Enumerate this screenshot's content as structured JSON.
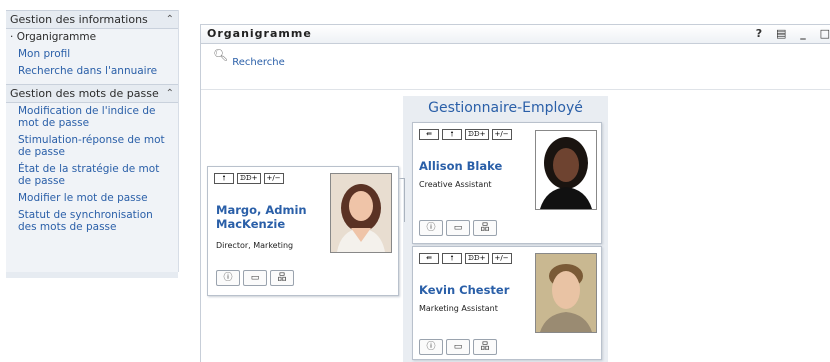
{
  "sidebar": {
    "section1": {
      "label": "Gestion des informations",
      "collapse": "⌃"
    },
    "items1": [
      {
        "label": "Organigramme",
        "bullet": "·"
      },
      {
        "label": "Mon profil"
      },
      {
        "label": "Recherche dans l'annuaire"
      }
    ],
    "section2": {
      "label": "Gestion des mots de passe",
      "collapse": "⌃"
    },
    "items2": [
      {
        "label": "Modification de l'indice de mot de passe"
      },
      {
        "label": "Stimulation-réponse de mot de passe"
      },
      {
        "label": "État de la stratégie de mot de passe"
      },
      {
        "label": "Modifier le mot de passe"
      },
      {
        "label": "Statut de synchronisation des mots de passe"
      }
    ]
  },
  "portlet": {
    "title": "Organigramme",
    "tools": {
      "help": "?",
      "print": "▤",
      "minimize": "_",
      "maximize": "□"
    },
    "search_label": "Recherche"
  },
  "group": {
    "title": "Gestionnaire-Employé"
  },
  "manager": {
    "name_line1": "Margo, Admin",
    "name_line2": "MacKenzie",
    "title": "Director, Marketing",
    "toolbar": [
      "🠕",
      "ᗬᗬ+",
      "+/−"
    ]
  },
  "employees": [
    {
      "name": "Allison Blake",
      "title": "Creative Assistant",
      "toolbar": [
        "⇚",
        "🠕",
        "ᗬᗬ+",
        "+/−"
      ]
    },
    {
      "name": "Kevin Chester",
      "title": "Marketing Assistant",
      "toolbar": [
        "⇚",
        "🠕",
        "ᗬᗬ+",
        "+/−"
      ]
    }
  ],
  "actions": {
    "info": "ⓘ",
    "card": "▭",
    "org": "品"
  },
  "colors": {
    "link": "#2a5fa8",
    "panel": "#e9edf2",
    "sidebar": "#f0f3f7"
  }
}
